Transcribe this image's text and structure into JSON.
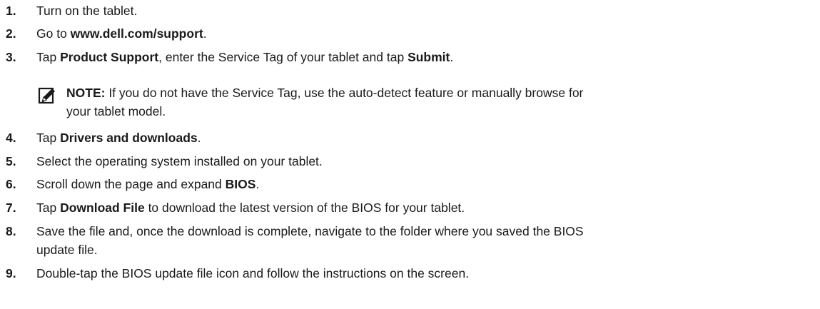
{
  "steps": [
    {
      "num": "1.",
      "parts": [
        {
          "t": "Turn on the tablet.",
          "b": false
        }
      ]
    },
    {
      "num": "2.",
      "parts": [
        {
          "t": "Go to ",
          "b": false
        },
        {
          "t": "www.dell.com/support",
          "b": true
        },
        {
          "t": ".",
          "b": false
        }
      ]
    },
    {
      "num": "3.",
      "parts": [
        {
          "t": "Tap ",
          "b": false
        },
        {
          "t": "Product Support",
          "b": true
        },
        {
          "t": ", enter the Service Tag of your tablet and tap ",
          "b": false
        },
        {
          "t": "Submit",
          "b": true
        },
        {
          "t": ".",
          "b": false
        }
      ]
    },
    {
      "num": "4.",
      "parts": [
        {
          "t": "Tap ",
          "b": false
        },
        {
          "t": "Drivers and downloads",
          "b": true
        },
        {
          "t": ".",
          "b": false
        }
      ]
    },
    {
      "num": "5.",
      "parts": [
        {
          "t": "Select the operating system installed on your tablet.",
          "b": false
        }
      ]
    },
    {
      "num": "6.",
      "parts": [
        {
          "t": "Scroll down the page and expand ",
          "b": false
        },
        {
          "t": "BIOS",
          "b": true
        },
        {
          "t": ".",
          "b": false
        }
      ]
    },
    {
      "num": "7.",
      "parts": [
        {
          "t": "Tap ",
          "b": false
        },
        {
          "t": "Download File",
          "b": true
        },
        {
          "t": " to download the latest version of the BIOS for your tablet.",
          "b": false
        }
      ]
    },
    {
      "num": "8.",
      "parts": [
        {
          "t": "Save the file and, once the download is complete, navigate to the folder where you saved the BIOS",
          "b": false
        }
      ],
      "line2": "update file."
    },
    {
      "num": "9.",
      "parts": [
        {
          "t": "Double-tap the BIOS update file icon and follow the instructions on the screen.",
          "b": false
        }
      ]
    }
  ],
  "note": {
    "icon": "pencil-icon",
    "label": "NOTE:",
    "line1": " If you do not have the Service Tag, use the auto-detect feature or manually browse for",
    "line2": "your tablet model."
  }
}
